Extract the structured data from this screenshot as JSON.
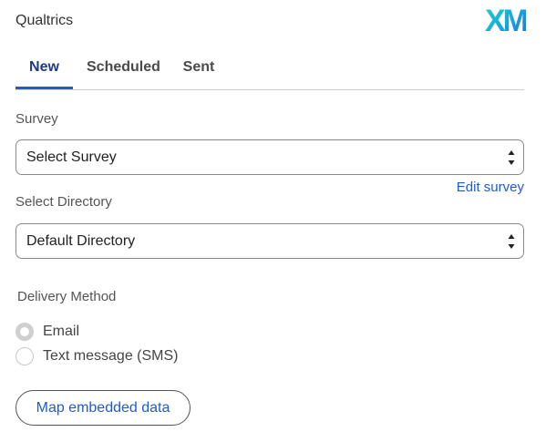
{
  "app": {
    "title": "Qualtrics",
    "logo_text": "XM"
  },
  "tabs": [
    {
      "label": "New",
      "active": true
    },
    {
      "label": "Scheduled",
      "active": false
    },
    {
      "label": "Sent",
      "active": false
    }
  ],
  "survey": {
    "label": "Survey",
    "selected": "Select Survey",
    "edit_link": "Edit survey"
  },
  "directory": {
    "label": "Select Directory",
    "selected": "Default Directory"
  },
  "delivery": {
    "label": "Delivery Method",
    "options": [
      {
        "label": "Email",
        "selected": true
      },
      {
        "label": "Text message (SMS)",
        "selected": false
      }
    ]
  },
  "actions": {
    "map_embedded_data": "Map embedded data"
  },
  "colors": {
    "accent": "#1f5ccc",
    "active_tab_text": "#1f3a8a"
  },
  "icons": [
    "select-arrows-icon",
    "radio-icon"
  ]
}
